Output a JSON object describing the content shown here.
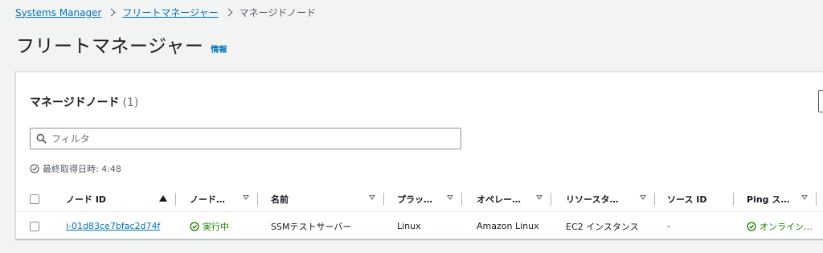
{
  "breadcrumb": {
    "items": [
      "Systems Manager",
      "フリートマネージャー"
    ],
    "current": "マネージドノード"
  },
  "page": {
    "title": "フリートマネージャー",
    "info_label": "情報"
  },
  "panel": {
    "title": "マネージドノード",
    "count": "(1)",
    "filter_placeholder": "フィルタ",
    "last_fetched": "最終取得日時: 4:48"
  },
  "table": {
    "columns": [
      "ノード ID",
      "ノード…",
      "名前",
      "プラッ…",
      "オペレー…",
      "リソースタ…",
      "ソース ID",
      "Ping ス…"
    ],
    "rows": [
      {
        "node_id": "i-01d83ce7bfac2d74f",
        "node_state": "実行中",
        "name": "SSMテストサーバー",
        "platform": "Linux",
        "os": "Amazon Linux",
        "resource_type": "EC2 インスタンス",
        "source_id": "-",
        "ping_status": "オンライン…"
      }
    ]
  },
  "colors": {
    "link": "#0073bb",
    "success": "#1d8102",
    "background": "#f2f3f3"
  }
}
